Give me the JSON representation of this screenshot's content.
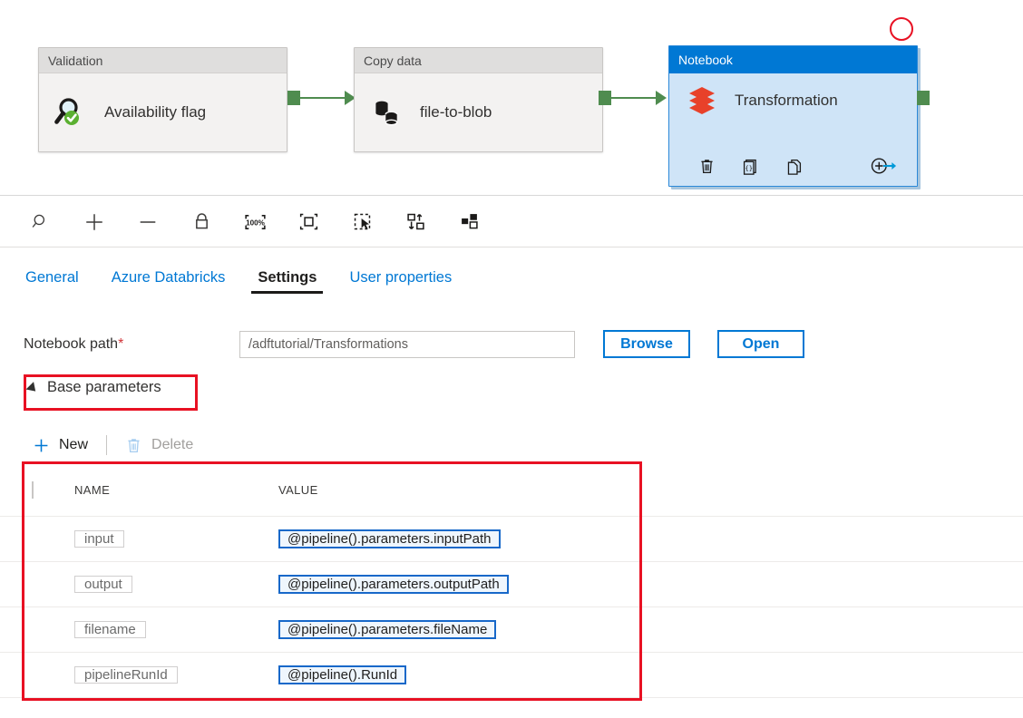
{
  "canvas": {
    "activities": [
      {
        "type_label": "Validation",
        "name": "Availability flag",
        "icon": "magnifier-check-icon",
        "selected": false
      },
      {
        "type_label": "Copy data",
        "name": "file-to-blob",
        "icon": "copy-data-cylinders-icon",
        "selected": false
      },
      {
        "type_label": "Notebook",
        "name": "Transformation",
        "icon": "databricks-stack-icon",
        "selected": true
      }
    ],
    "notebook_toolbar": [
      {
        "name": "delete-activity",
        "icon": "trash-icon"
      },
      {
        "name": "code-activity",
        "icon": "code-braces-icon"
      },
      {
        "name": "clone-activity",
        "icon": "duplicate-pages-icon"
      },
      {
        "name": "add-output",
        "icon": "add-arrow-icon"
      }
    ],
    "annotation": {
      "shape": "circle",
      "color": "#e81123"
    }
  },
  "zoom_toolbar": {
    "buttons": [
      {
        "name": "search",
        "icon": "magnifier-icon",
        "label": ""
      },
      {
        "name": "zoom-in",
        "icon": "plus-icon",
        "label": ""
      },
      {
        "name": "zoom-out",
        "icon": "minus-icon",
        "label": ""
      },
      {
        "name": "lock-canvas",
        "icon": "lock-icon",
        "label": ""
      },
      {
        "name": "zoom-100",
        "icon": "zoom-100-percent-icon",
        "label": "100%"
      },
      {
        "name": "zoom-to-fit",
        "icon": "fit-to-screen-icon",
        "label": ""
      },
      {
        "name": "select-mode",
        "icon": "marquee-cursor-icon",
        "label": ""
      },
      {
        "name": "auto-align",
        "icon": "auto-align-icon",
        "label": ""
      },
      {
        "name": "arrange-layout",
        "icon": "arrange-squares-icon",
        "label": ""
      }
    ]
  },
  "tabs": [
    {
      "label": "General",
      "active": false
    },
    {
      "label": "Azure Databricks",
      "active": false
    },
    {
      "label": "Settings",
      "active": true
    },
    {
      "label": "User properties",
      "active": false
    }
  ],
  "settings": {
    "notebook_path": {
      "label": "Notebook path",
      "required_marker": "*",
      "value": "/adftutorial/Transformations",
      "browse_label": "Browse",
      "open_label": "Open"
    },
    "base_parameters": {
      "section_label": "Base parameters",
      "new_label": "New",
      "delete_label": "Delete",
      "columns": [
        "NAME",
        "VALUE"
      ],
      "rows": [
        {
          "name": "input",
          "value": "@pipeline().parameters.inputPath"
        },
        {
          "name": "output",
          "value": "@pipeline().parameters.outputPath"
        },
        {
          "name": "filename",
          "value": "@pipeline().parameters.fileName"
        },
        {
          "name": "pipelineRunId",
          "value": "@pipeline().RunId"
        }
      ]
    }
  },
  "colors": {
    "accent_blue": "#0078d4",
    "annotation_red": "#e81123",
    "connector_green": "#4f8c4f",
    "databricks_red": "#e8412a",
    "value_border_blue": "#1768c9"
  }
}
